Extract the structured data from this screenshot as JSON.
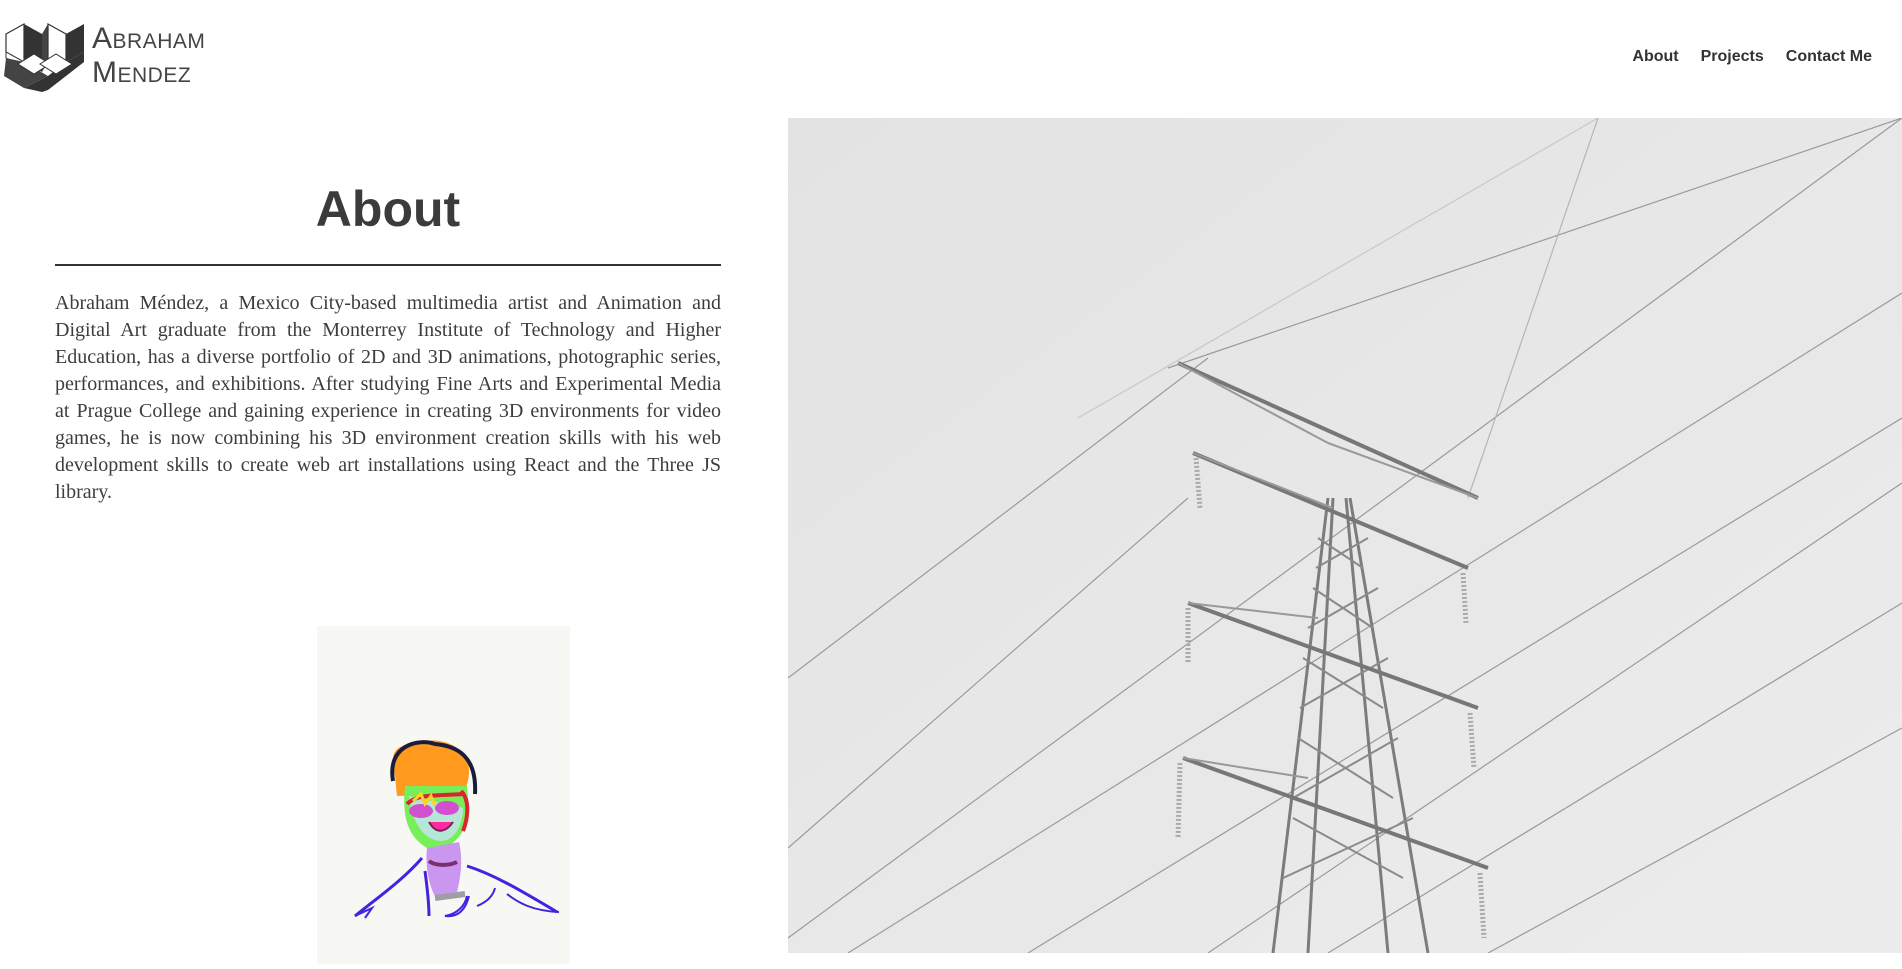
{
  "logo": {
    "line1_cap": "A",
    "line1_rest": "BRAHAM",
    "line2_cap": "M",
    "line2_rest": "ENDEZ"
  },
  "nav": {
    "items": [
      {
        "label": "About"
      },
      {
        "label": "Projects"
      },
      {
        "label": "Contact Me"
      }
    ]
  },
  "about": {
    "title": "About",
    "body": "Abraham Méndez, a Mexico City-based multimedia artist and Animation and Digital Art graduate from the Monterrey Institute of Technology and Higher Education, has a diverse portfolio of 2D and 3D animations, photographic series, performances, and exhibitions. After studying Fine Arts and Experimental Media at Prague College and gaining experience in creating 3D environments for video games, he is now combining his 3D environment creation skills with his web development skills to create web art installations using React and the Three JS library."
  },
  "colors": {
    "text": "#333333",
    "hero_bg": "#e5e5e5",
    "portrait_bg": "#f7f7f3"
  }
}
